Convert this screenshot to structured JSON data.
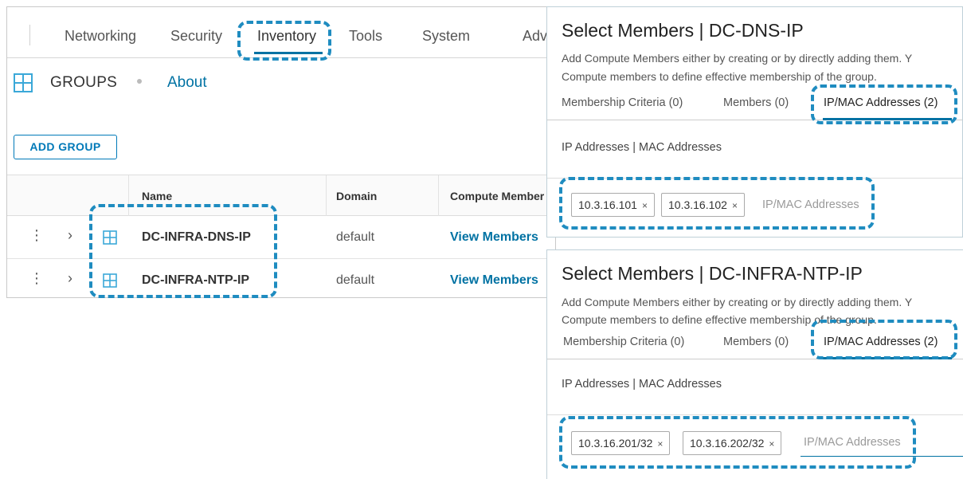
{
  "nav": {
    "items": [
      "Networking",
      "Security",
      "Inventory",
      "Tools",
      "System",
      "Adv"
    ],
    "active": "Inventory"
  },
  "groups": {
    "title": "GROUPS",
    "about": "About",
    "add_button": "ADD GROUP"
  },
  "table": {
    "headers": {
      "name": "Name",
      "domain": "Domain",
      "compute": "Compute Member"
    },
    "rows": [
      {
        "name": "DC-INFRA-DNS-IP",
        "domain": "default",
        "link": "View Members"
      },
      {
        "name": "DC-INFRA-NTP-IP",
        "domain": "default",
        "link": "View Members"
      }
    ]
  },
  "dns_panel": {
    "title": "Select Members | DC-DNS-IP",
    "desc1": "Add Compute Members either by creating or by directly adding them. Y",
    "desc2": "Compute members to define effective membership of the group.",
    "tabs": [
      "Membership Criteria (0)",
      "Members (0)",
      "IP/MAC Addresses (2)"
    ],
    "subheading": "IP Addresses | MAC Addresses",
    "chips": [
      "10.3.16.101",
      "10.3.16.102"
    ],
    "placeholder": "IP/MAC Addresses"
  },
  "ntp_panel": {
    "title": "Select Members | DC-INFRA-NTP-IP",
    "desc1": "Add Compute Members either by creating or by directly adding them. Y",
    "desc2": "Compute members to define effective membership of the group.",
    "tabs": [
      "Membership Criteria (0)",
      "Members (0)",
      "IP/MAC Addresses (2)"
    ],
    "subheading": "IP Addresses | MAC Addresses",
    "chips": [
      "10.3.16.201/32",
      "10.3.16.202/32"
    ],
    "placeholder": "IP/MAC Addresses"
  },
  "chip_remove_glyph": "×",
  "colors": {
    "accent": "#0072a3",
    "highlight": "#1f8cc0",
    "icon": "#3ba8d8"
  },
  "icons": {
    "groups": "groups-grid-icon",
    "row": "group-row-icon",
    "kebab": "kebab-menu-icon",
    "chevron": "chevron-right-icon",
    "remove": "close-icon"
  }
}
